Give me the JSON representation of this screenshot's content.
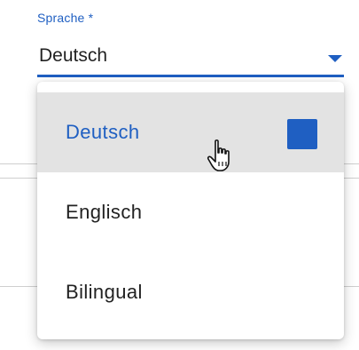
{
  "field": {
    "label": "Sprache *",
    "value": "Deutsch"
  },
  "menu": {
    "options": [
      {
        "label": "Deutsch",
        "selected": true
      },
      {
        "label": "Englisch",
        "selected": false
      },
      {
        "label": "Bilingual",
        "selected": false
      }
    ]
  },
  "colors": {
    "accent": "#1f5fc2",
    "hover_bg": "#e3e3e3",
    "text": "#222222"
  },
  "icons": {
    "dropdown": "chevron-down-icon",
    "cursor": "hand-pointer-cursor-icon",
    "selected": "selected-square-icon"
  }
}
